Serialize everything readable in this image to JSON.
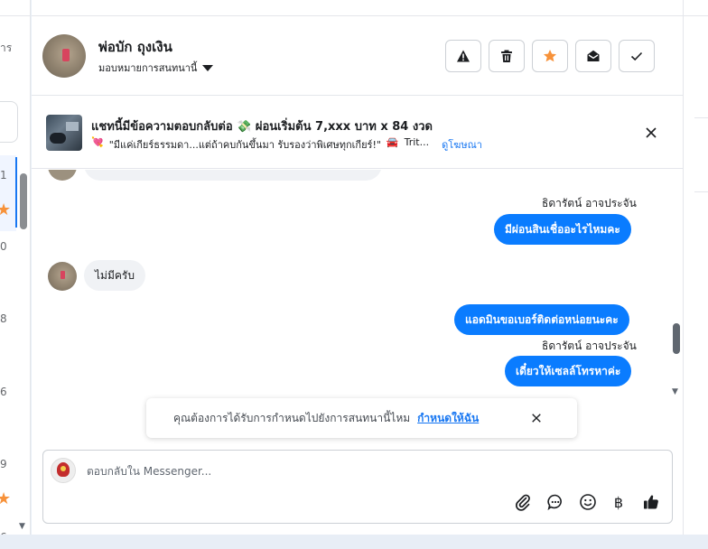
{
  "left_list": {
    "top_label": "าร",
    "numbers": [
      "1",
      "0",
      "8",
      "6",
      "9",
      "6"
    ]
  },
  "header": {
    "contact_name": "พ่อบัก ถุงเงิน",
    "assign_label": "มอบหมายการสนทนานี้",
    "buttons": [
      "warning-icon",
      "trash-icon",
      "star-icon",
      "mark-unread-icon",
      "check-icon"
    ]
  },
  "ad_banner": {
    "title": "แชทนี้มีข้อความตอบกลับต่อ 💸 ผ่อนเริ่มต้น 7,xxx บาท x 84 งวด",
    "heart": "💘",
    "quote": "\"มีแค่เกียร์ธรรมดา...แต่ถ้าคบกันขึ้นมา รับรองว่าพิเศษทุกเกียร์!\"",
    "car": "🚘",
    "trunc": "Trit...",
    "link": "ดูโฆษณา"
  },
  "messages": [
    {
      "dir": "out",
      "sender": "ธิดารัตน์ อาจประจัน",
      "text": "มีผ่อนสินเชื่ออะไรไหมคะ"
    },
    {
      "dir": "in",
      "text": "ไม่มีครับ"
    },
    {
      "dir": "out",
      "text": "แอดมินขอเบอร์ติดต่อหน่อยนะคะ"
    },
    {
      "dir": "out",
      "sender": "ธิดารัตน์ อาจประจัน",
      "text": "เดี๋ยวให้เซลล์โทรหาค่ะ"
    }
  ],
  "schedule_prompt": {
    "text": "คุณต้องการได้รับการกำหนดไปยังการสนทนานี้ไหม",
    "link": "กำหนดให้ฉัน"
  },
  "composer": {
    "placeholder": "ตอบกลับใน Messenger...",
    "tools": [
      "attach-icon",
      "saved-reply-icon",
      "emoji-icon",
      "baht-icon",
      "thumbs-up-icon"
    ],
    "baht_symbol": "฿"
  },
  "colors": {
    "accent": "#0a7cff",
    "link": "#1877f2",
    "star": "#f7923a"
  }
}
